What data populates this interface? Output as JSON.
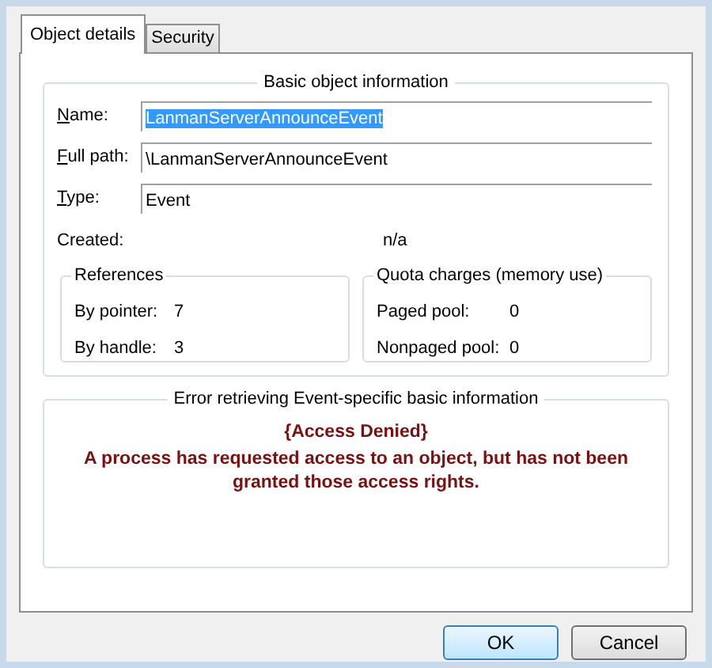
{
  "tabs": [
    {
      "label": "Object details",
      "selected": true
    },
    {
      "label": "Security",
      "selected": false
    }
  ],
  "basic_info": {
    "title": "Basic object information",
    "fields": [
      {
        "label": "Name:",
        "value": "LanmanServerAnnounceEvent",
        "selected": true
      },
      {
        "label": "Full path:",
        "value": "\\LanmanServerAnnounceEvent",
        "selected": false
      },
      {
        "label": "Type:",
        "value": "Event",
        "selected": false
      }
    ],
    "created": {
      "label": "Created:",
      "value": "n/a"
    },
    "references": {
      "title": "References",
      "rows": [
        {
          "label": "By pointer:",
          "value": "7"
        },
        {
          "label": "By handle:",
          "value": "3"
        }
      ]
    },
    "quota": {
      "title": "Quota charges (memory use)",
      "rows": [
        {
          "label": "Paged pool:",
          "value": "0"
        },
        {
          "label": "Nonpaged pool:",
          "value": "0"
        }
      ]
    }
  },
  "error": {
    "title": "Error retrieving Event-specific basic information",
    "heading": "{Access Denied}",
    "message": "A process has requested access to an object, but has not been granted those access rights."
  },
  "buttons": [
    {
      "label": "OK",
      "kind": "default"
    },
    {
      "label": "Cancel",
      "kind": "normal"
    }
  ]
}
